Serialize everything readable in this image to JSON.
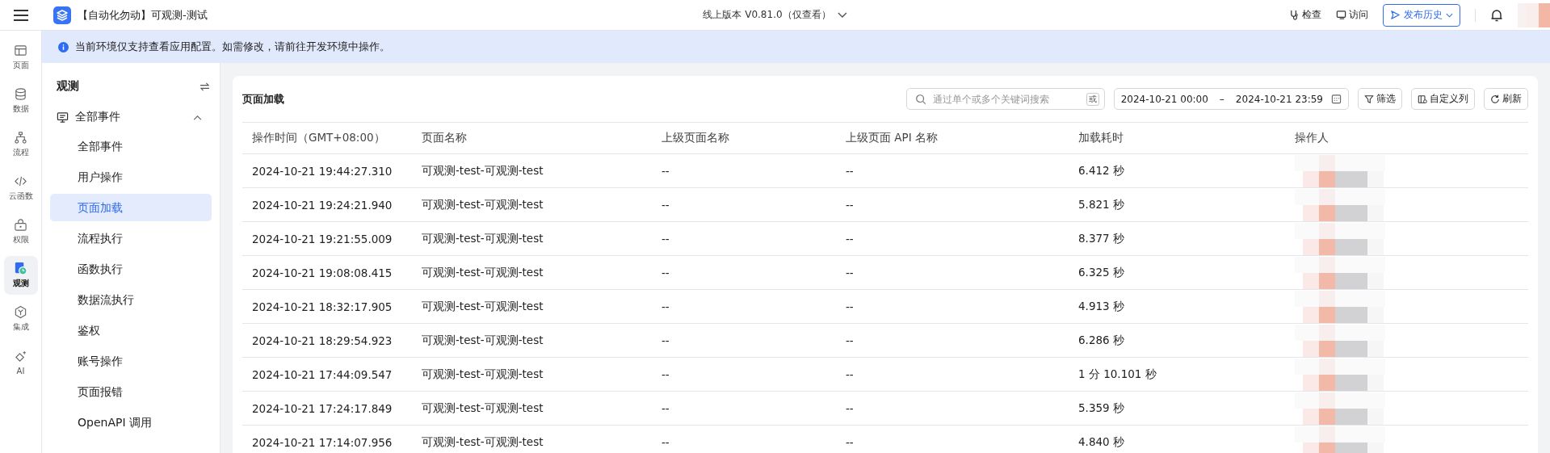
{
  "topbar": {
    "app_title": "【自动化勿动】可观测-测试",
    "version": "线上版本 V0.81.0（仅查看）",
    "actions": [
      {
        "kind": "inspect",
        "label": "检查"
      },
      {
        "kind": "visit",
        "label": "访问"
      }
    ],
    "publish_button": "发布历史"
  },
  "banner": "当前环境仅支持查看应用配置。如需修改，请前往开发环境中操作。",
  "rail": [
    {
      "kind": "page",
      "label": "页面",
      "selected": false
    },
    {
      "kind": "data",
      "label": "数据",
      "selected": false
    },
    {
      "kind": "flow",
      "label": "流程",
      "selected": false
    },
    {
      "kind": "code",
      "label": "云函数",
      "selected": false
    },
    {
      "kind": "lock",
      "label": "权限",
      "selected": false
    },
    {
      "kind": "observe",
      "label": "观测",
      "selected": true
    },
    {
      "kind": "integrate",
      "label": "集成",
      "selected": false
    },
    {
      "kind": "ai",
      "label": "AI",
      "selected": false
    }
  ],
  "nav": {
    "title": "观测",
    "groups": [
      {
        "label": "全部事件",
        "expanded": true,
        "children": [
          {
            "label": "全部事件",
            "selected": false
          },
          {
            "label": "用户操作",
            "selected": false
          },
          {
            "label": "页面加载",
            "selected": true
          },
          {
            "label": "流程执行",
            "selected": false
          },
          {
            "label": "函数执行",
            "selected": false
          },
          {
            "label": "数据流执行",
            "selected": false
          },
          {
            "label": "鉴权",
            "selected": false
          },
          {
            "label": "账号操作",
            "selected": false
          },
          {
            "label": "页面报错",
            "selected": false
          },
          {
            "label": "OpenAPI 调用",
            "selected": false
          }
        ]
      }
    ]
  },
  "panel": {
    "title": "页面加载",
    "search": {
      "placeholder": "通过单个或多个关键词搜索",
      "mode": "或"
    },
    "date_range": {
      "start": "2024-10-21 00:00",
      "separator": "–",
      "end": "2024-10-21 23:59"
    },
    "buttons": [
      {
        "kind": "filter",
        "label": "筛选"
      },
      {
        "kind": "columns",
        "label": "自定义列"
      },
      {
        "kind": "refresh",
        "label": "刷新"
      }
    ],
    "table": {
      "columns": [
        "操作时间（GMT+08:00）",
        "页面名称",
        "上级页面名称",
        "上级页面 API 名称",
        "加载耗时",
        "操作人"
      ],
      "rows": [
        [
          "2024-10-21 19:44:27.310",
          "可观测-test-可观测-test",
          "--",
          "--",
          "6.412 秒"
        ],
        [
          "2024-10-21 19:24:21.940",
          "可观测-test-可观测-test",
          "--",
          "--",
          "5.821 秒"
        ],
        [
          "2024-10-21 19:21:55.009",
          "可观测-test-可观测-test",
          "--",
          "--",
          "8.377 秒"
        ],
        [
          "2024-10-21 19:08:08.415",
          "可观测-test-可观测-test",
          "--",
          "--",
          "6.325 秒"
        ],
        [
          "2024-10-21 18:32:17.905",
          "可观测-test-可观测-test",
          "--",
          "--",
          "4.913 秒"
        ],
        [
          "2024-10-21 18:29:54.923",
          "可观测-test-可观测-test",
          "--",
          "--",
          "6.286 秒"
        ],
        [
          "2024-10-21 17:44:09.547",
          "可观测-test-可观测-test",
          "--",
          "--",
          "1 分 10.101 秒"
        ],
        [
          "2024-10-21 17:24:17.849",
          "可观测-test-可观测-test",
          "--",
          "--",
          "5.359 秒"
        ],
        [
          "2024-10-21 17:14:07.956",
          "可观测-test-可观测-test",
          "--",
          "--",
          "4.840 秒"
        ]
      ]
    }
  }
}
